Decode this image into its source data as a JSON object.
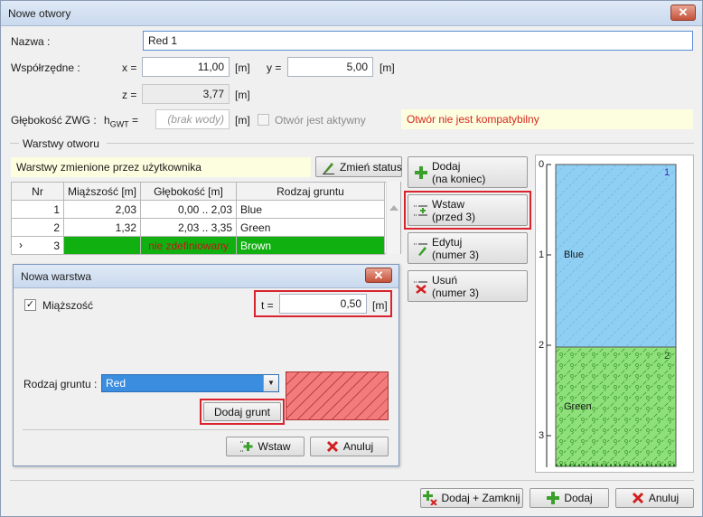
{
  "window": {
    "title": "Nowe otwory",
    "close_glyph": "✕"
  },
  "fields": {
    "name_label": "Nazwa :",
    "name_value": "Red 1",
    "coords_label": "Współrzędne :",
    "x_label": "x =",
    "x_value": "11,00",
    "x_unit": "[m]",
    "y_label": "y =",
    "y_value": "5,00",
    "y_unit": "[m]",
    "z_label": "z =",
    "z_value": "3,77",
    "z_unit": "[m]",
    "gwt_label": "Głębokość ZWG :",
    "hgwt_label": "h",
    "hgwt_sub": "GWT",
    "hgwt_eq": " =",
    "hgwt_placeholder": "(brak wody)",
    "hgwt_unit": "[m]",
    "active_label": "Otwór jest aktywny",
    "incompatible_msg": "Otwór nie jest kompatybilny"
  },
  "layers": {
    "group_title": "Warstwy otworu",
    "status_msg": "Warstwy zmienione przez użytkownika",
    "change_status_button": "Zmień status",
    "columns": [
      "Nr",
      "Miąższość [m]",
      "Głębokość [m]",
      "Rodzaj gruntu"
    ],
    "rows": [
      {
        "nr": "1",
        "thickness": "2,03",
        "depth": "0,00 .. 2,03",
        "soil": "Blue"
      },
      {
        "nr": "2",
        "thickness": "1,32",
        "depth": "2,03 .. 3,35",
        "soil": "Green"
      },
      {
        "nr": "3",
        "thickness": "",
        "depth": "nie zdefiniowany",
        "soil": "Brown",
        "marker": "›"
      }
    ]
  },
  "side_buttons": {
    "add": {
      "line1": "Dodaj",
      "line2": "(na koniec)"
    },
    "insert": {
      "line1": "Wstaw",
      "line2": "(przed 3)"
    },
    "edit": {
      "line1": "Edytuj",
      "line2": "(numer 3)"
    },
    "remove": {
      "line1": "Usuń",
      "line2": "(numer 3)"
    }
  },
  "dialog": {
    "title": "Nowa warstwa",
    "close_glyph": "✕",
    "thickness_check_label": "Miąższość",
    "check_glyph": "✓",
    "t_label": "t =",
    "t_value": "0,50",
    "t_unit": "[m]",
    "soil_label": "Rodzaj gruntu :",
    "soil_value": "Red",
    "add_soil_button": "Dodaj grunt",
    "insert_button": "Wstaw",
    "cancel_button": "Anuluj",
    "swatch_color": "#f47b7b"
  },
  "profile": {
    "ticks": [
      "0",
      "1",
      "2",
      "3"
    ],
    "layers": [
      {
        "label": "Blue",
        "number": "1",
        "color": "#8fcff3"
      },
      {
        "label": "Green",
        "number": "2",
        "color": "#8ee07a"
      }
    ]
  },
  "footer": {
    "add_close_button": "Dodaj + Zamknij",
    "add_button": "Dodaj",
    "cancel_button": "Anuluj"
  }
}
